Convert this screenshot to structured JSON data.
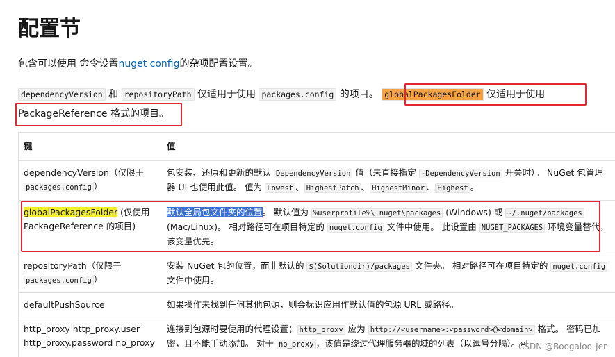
{
  "page": {
    "title": "配置节",
    "intro": {
      "before": "包含可以使用 命令设置",
      "link": "nuget config",
      "after": "的杂项配置设置。"
    },
    "scope_note": {
      "code1": "dependencyVersion",
      "and": " 和 ",
      "code2": "repositoryPath",
      "text1": " 仅适用于使用 ",
      "code3": "packages.config",
      "text2": " 的项目。 ",
      "code4": "globalPackagesFolder",
      "text3": " 仅适用于使用 PackageReference 格式的项目。"
    }
  },
  "table": {
    "headers": [
      "键",
      "值"
    ],
    "rows": [
      {
        "key_text": "dependencyVersion（仅限于",
        "key_code": "packages.config",
        "key_tail": "）",
        "v1": "包安装、还原和更新的默认 ",
        "c1": "DependencyVersion",
        "v2": " 值（未直接指定 ",
        "c2": "-DependencyVersion",
        "v3": " 开关时）。 NuGet 包管理器 UI 也使用此值。 值为 ",
        "c3": "Lowest",
        "s1": "、",
        "c4": "HighestPatch",
        "s2": "、",
        "c5": "HighestMinor",
        "s3": "、",
        "c6": "Highest",
        "end": "。"
      },
      {
        "key_hl": "globalPackagesFolder",
        "key_tail": " (仅使用 PackageReference 的项目)",
        "v_hl": "默认全局包文件夹的位置",
        "v1": "。 默认值为 ",
        "c1": "%userprofile%\\.nuget\\packages",
        "v2": " (Windows) 或 ",
        "c2": "~/.nuget/packages",
        "v3": " (Mac/Linux)。 相对路径可在项目特定的 ",
        "c3": "nuget.config",
        "v4": " 文件中使用。 此设置由 ",
        "c4": "NUGET_PACKAGES",
        "v5": " 环境变量替代，该变量优先。"
      },
      {
        "key_text": "repositoryPath（仅限于",
        "key_code": "packages.config",
        "key_tail": "）",
        "v1": "安装 NuGet 包的位置，而非默认的 ",
        "c1": "$(Solutiondir)/packages",
        "v2": " 文件夹。 相对路径可在项目特定的 ",
        "c2": "nuget.config",
        "v3": " 文件中使用。"
      },
      {
        "key_text": "defaultPushSource",
        "v1": "如果操作未找到任何其他包源，则会标识应用作默认值的包源 URL 或路径。"
      },
      {
        "key_text": "http_proxy http_proxy.user http_proxy.password no_proxy",
        "v1": "连接到包源时要使用的代理设置；",
        "c1": "http_proxy",
        "v2": " 应为 ",
        "c2": "http://<username>:<password>@<domain>",
        "v3": " 格式。 密码已加密，且不能手动添加。 对于 ",
        "c3": "no_proxy",
        "v4": "，该值是绕过代理服务器的域的列表（以逗号分隔）。可"
      }
    ]
  },
  "watermark": "CSDN @Boogaloo-Jer",
  "colors": {
    "link": "#0065b3",
    "highlight_orange": "#f4a142",
    "highlight_yellow": "#f5ee2c",
    "selection_blue": "#3b6fd8",
    "annotation_red": "#e2282e"
  }
}
